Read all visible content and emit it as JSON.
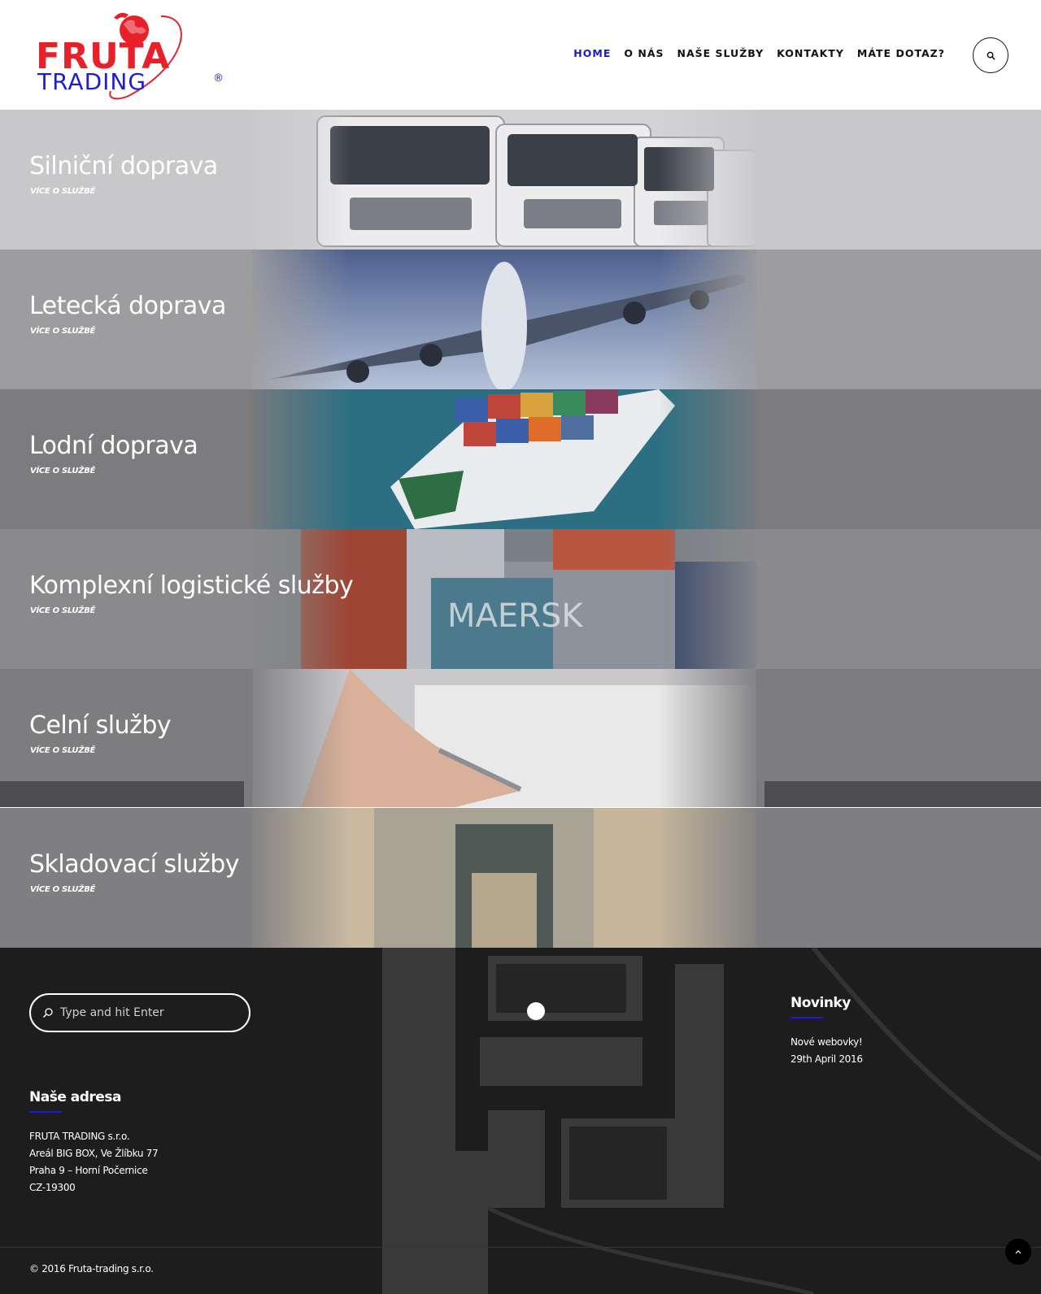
{
  "brand": {
    "line1": "FRUTA",
    "line2": "TRADING",
    "mark": "®"
  },
  "nav": [
    {
      "label": "HOME"
    },
    {
      "label": "O NÁS"
    },
    {
      "label": "NAŠE SLUŽBY"
    },
    {
      "label": "KONTAKTY"
    },
    {
      "label": "MÁTE DOTAZ?"
    }
  ],
  "header_search_icon": "search-icon",
  "services": [
    {
      "title": "Silniční doprava",
      "more": "VÍCE O SLUŽBĚ"
    },
    {
      "title": "Letecká doprava",
      "more": "VÍCE O SLUŽBĚ"
    },
    {
      "title": "Lodní doprava",
      "more": "VÍCE O SLUŽBĚ"
    },
    {
      "title": "Komplexní logistické služby",
      "more": "VÍCE O SLUŽBĚ"
    },
    {
      "title": "Celní služby",
      "more": "VÍCE O SLUŽBĚ"
    },
    {
      "title": "Skladovací služby",
      "more": "VÍCE O SLUŽBĚ"
    }
  ],
  "footer": {
    "search": {
      "placeholder": "Type and hit Enter"
    },
    "address": {
      "title": "Naše adresa",
      "lines": [
        "FRUTA TRADING s.r.o.",
        "Areál BIG BOX, Ve Žlíbku 77",
        "Praha 9 – Horní Počernice",
        "CZ-19300"
      ]
    },
    "news": {
      "title": "Novinky",
      "item": "Nové webovky!",
      "date": "29th April 2016"
    },
    "copyright": "© 2016 Fruta-trading s.r.o."
  },
  "colors": {
    "accent": "#1a1ac8",
    "logo_red": "#e8202a",
    "logo_blue": "#1d1dd6"
  }
}
